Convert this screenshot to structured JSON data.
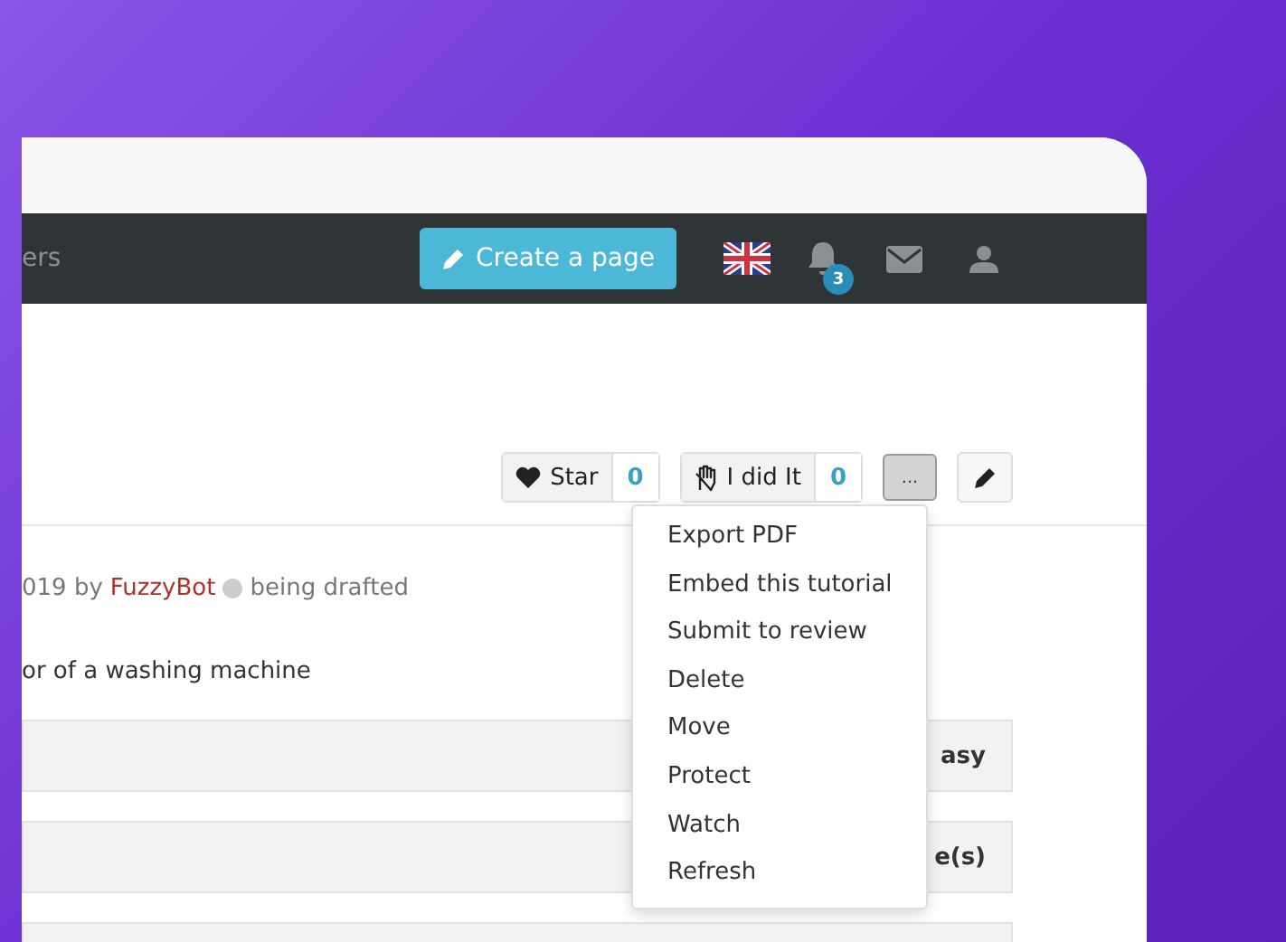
{
  "navbar": {
    "nav_link": "ers",
    "create_button": "Create a page",
    "notification_count": "3"
  },
  "actions": {
    "star": {
      "label": "Star",
      "count": "0"
    },
    "did_it": {
      "label": "I did It",
      "count": "0"
    },
    "more": {
      "label": "...",
      "selected": true
    }
  },
  "meta": {
    "prefix": "019 by",
    "author": "FuzzyBot",
    "status": "being drafted",
    "status_dot": {
      "color": "#cccccc"
    }
  },
  "summary": "or of a washing machine",
  "info_rows": [
    {
      "value": "asy"
    },
    {
      "value": "e(s)"
    }
  ],
  "dropdown": [
    "Export PDF",
    "Embed this tutorial",
    "Submit to review",
    "Delete",
    "Move",
    "Protect",
    "Watch",
    "Refresh"
  ]
}
